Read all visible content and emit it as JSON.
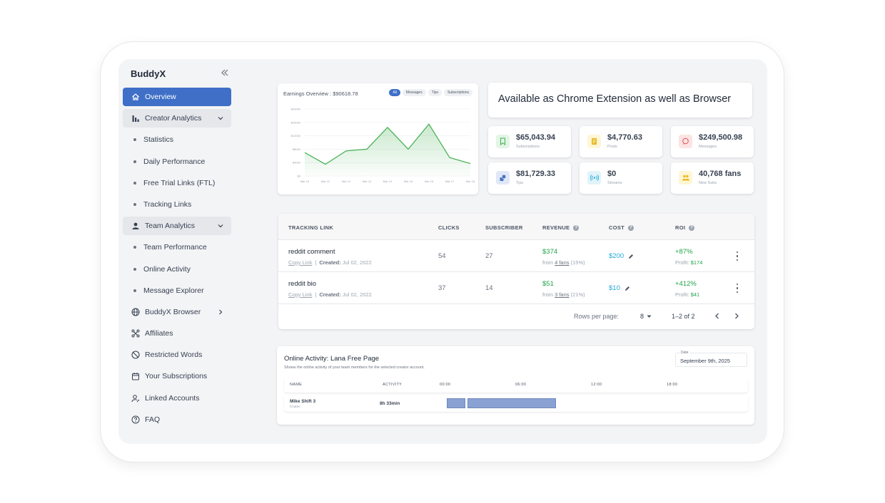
{
  "sidebar": {
    "brand": "BuddyX",
    "items": [
      {
        "label": "Overview"
      },
      {
        "label": "Creator Analytics"
      },
      {
        "label": "Statistics"
      },
      {
        "label": "Daily Performance"
      },
      {
        "label": "Free Trial Links (FTL)"
      },
      {
        "label": "Tracking Links"
      },
      {
        "label": "Team Analytics"
      },
      {
        "label": "Team Performance"
      },
      {
        "label": "Online Activity"
      },
      {
        "label": "Message Explorer"
      },
      {
        "label": "BuddyX Browser"
      },
      {
        "label": "Affiliates"
      },
      {
        "label": "Restricted Words"
      },
      {
        "label": "Your Subscriptions"
      },
      {
        "label": "Linked Accounts"
      },
      {
        "label": "FAQ"
      }
    ]
  },
  "earnings": {
    "title": "Earnings Overview : $90618.78",
    "filters": [
      "All",
      "Messages",
      "Tips",
      "Subscriptions"
    ],
    "active_filter": "All"
  },
  "chart_data": {
    "type": "area",
    "title": "Earnings Overview : $90618.78",
    "xlabel": "",
    "ylabel": "",
    "categories": [
      "Mar 10",
      "Mar 11",
      "Mar 12",
      "Mar 13",
      "Mar 14",
      "Mar 15",
      "Mar 16",
      "Mar 17",
      "Mar 18"
    ],
    "y_ticks": [
      "$0",
      "$4000",
      "$8000",
      "$12000",
      "$16000",
      "$20000"
    ],
    "ylim": [
      0,
      20000
    ],
    "series": [
      {
        "values": [
          7000,
          3500,
          7500,
          8000,
          14500,
          8000,
          15500,
          5500,
          3700
        ],
        "color": "#3fae4e"
      }
    ],
    "grid": true
  },
  "promo": {
    "text": "Available as Chrome Extension as well as Browser"
  },
  "stats": [
    {
      "value": "$65,043.94",
      "label": "Subscriptions",
      "icon": "bookmark-icon",
      "bg": "#e3f5e6",
      "fg": "#3fae4e"
    },
    {
      "value": "$4,770.63",
      "label": "Posts",
      "icon": "document-icon",
      "bg": "#fff6d6",
      "fg": "#e8b923"
    },
    {
      "value": "$249,500.98",
      "label": "Messages",
      "icon": "chat-icon",
      "bg": "#fde3e3",
      "fg": "#e05252"
    },
    {
      "value": "$81,729.33",
      "label": "Tips",
      "icon": "coins-icon",
      "bg": "#e0e8f8",
      "fg": "#4a6fbf"
    },
    {
      "value": "$0",
      "label": "Streams",
      "icon": "broadcast-icon",
      "bg": "#e0f4fa",
      "fg": "#24a8d8"
    },
    {
      "value": "40,768 fans",
      "label": "New Subs",
      "icon": "users-icon",
      "bg": "#fff6d6",
      "fg": "#e8b923"
    }
  ],
  "tracking": {
    "columns": [
      "TRACKING LINK",
      "CLICKS",
      "SUBSCRIBER",
      "REVENUE",
      "COST",
      "ROI"
    ],
    "rows": [
      {
        "name": "reddit comment",
        "copy": "Copy Link",
        "created_label": "Created:",
        "created": "Jul 02, 2022",
        "clicks": "54",
        "subscriber": "27",
        "revenue": "$374",
        "rev_from": "from",
        "rev_fans": "4 fans",
        "rev_pct": "(15%)",
        "cost": "$200",
        "roi": "+87%",
        "profit_label": "Profit:",
        "profit": "$174"
      },
      {
        "name": "reddit bio",
        "copy": "Copy Link",
        "created_label": "Created:",
        "created": "Jul 02, 2022",
        "clicks": "37",
        "subscriber": "14",
        "revenue": "$51",
        "rev_from": "from",
        "rev_fans": "3 fans",
        "rev_pct": "(21%)",
        "cost": "$10",
        "roi": "+412%",
        "profit_label": "Profit:",
        "profit": "$41"
      }
    ],
    "rows_per_page_label": "Rows per page:",
    "rows_per_page": "8",
    "range": "1–2 of 2"
  },
  "online": {
    "title": "Online Activity: Lana Free Page",
    "subtitle": "Shows the online activity of your team members for the selected creator account.",
    "date_label": "Date",
    "date_value": "September 9th, 2025",
    "columns": [
      "NAME",
      "ACTIVITY",
      "00:00",
      "06:00",
      "12:00",
      "18:00"
    ],
    "rows": [
      {
        "name": "Mike Shift 3",
        "role": "Chatter",
        "activity": "8h 33min"
      }
    ]
  }
}
